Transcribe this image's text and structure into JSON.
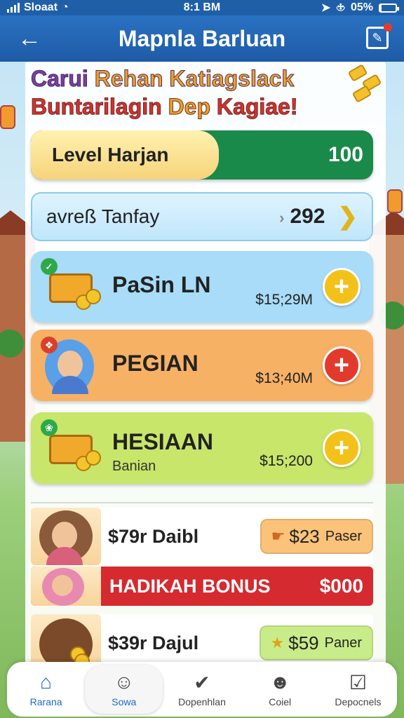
{
  "status_bar": {
    "carrier": "Sloaat",
    "time": "8:1 BM",
    "battery": "05%"
  },
  "app_bar": {
    "title": "Mapnla Barluan"
  },
  "headline": {
    "line1_part1": "Carui ",
    "line1_part2": "Rehan Katiagslack",
    "line2_part1": "Buntarilagin ",
    "line2_part2": "Dep ",
    "line2_part3": "Kagiae!"
  },
  "level": {
    "label": "Level Harjan",
    "value": "100",
    "progress_percent": 55
  },
  "average": {
    "label": "avreß Tanfay",
    "value": "292"
  },
  "cards": [
    {
      "title": "PaSin LN",
      "sub": "",
      "amount": "$15;29M",
      "color": "#a8dcf8",
      "plus_color": "#f2c21a"
    },
    {
      "title": "PEGIAN",
      "sub": "",
      "amount": "$13;40M",
      "color": "#f7b165",
      "plus_color": "#e23a2c"
    },
    {
      "title": "HESIAAN",
      "sub": "Banian",
      "amount": "$15;200",
      "color": "#c8e66a",
      "plus_color": "#f2c21a"
    }
  ],
  "rows": [
    {
      "text": "$79r Daibl",
      "btn_value": "$23",
      "btn_label": "Paser",
      "btn_color": "#fbc27a"
    },
    {
      "text": "$39r Dajul",
      "btn_value": "$59",
      "btn_label": "Paner",
      "btn_color": "#c9ec8a"
    }
  ],
  "bonus": {
    "title": "HADIKAH BONUS",
    "value": "$000"
  },
  "nav": [
    {
      "label": "Rarana",
      "icon": "home-icon"
    },
    {
      "label": "Sowa",
      "icon": "face-icon"
    },
    {
      "label": "Dopenhlan",
      "icon": "check-circle-icon"
    },
    {
      "label": "Coiel",
      "icon": "person-icon"
    },
    {
      "label": "Depocnels",
      "icon": "checkbox-icon"
    }
  ],
  "colors": {
    "app_bar": "#1e5ba6",
    "level_track": "#1a8a4a",
    "bonus": "#d42a30",
    "accent_blue": "#1e6ac8"
  }
}
